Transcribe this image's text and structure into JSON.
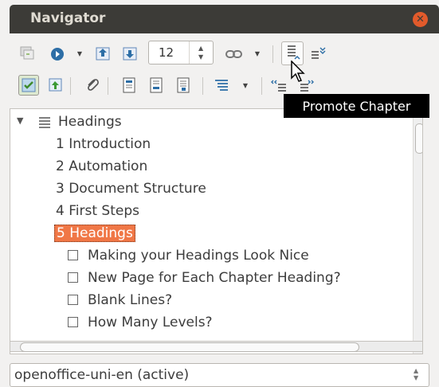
{
  "window": {
    "title": "Navigator"
  },
  "toolbar": {
    "heading_level": "12",
    "tooltip": "Promote Chapter"
  },
  "tree": {
    "root": "Headings",
    "chapters": [
      "1 Introduction",
      "2 Automation",
      "3 Document Structure",
      "4 First Steps"
    ],
    "selected": "5 Headings",
    "subitems": [
      "Making your Headings Look Nice",
      "New Page for Each Chapter Heading?",
      "Blank Lines?",
      "How Many Levels?"
    ]
  },
  "document_select": {
    "value": "openoffice-uni-en (active)"
  },
  "colors": {
    "titlebar": "#3c3b37",
    "close": "#e25a2b",
    "selection": "#f07746",
    "tooltip_bg": "#000000"
  },
  "icons": {
    "toolbar_row1": [
      "toggle-icon",
      "navigation-icon",
      "previous-icon",
      "next-icon",
      "drag-mode-icon",
      "promote-chapter-icon",
      "demote-chapter-icon"
    ],
    "toolbar_row2": [
      "content-view-icon",
      "set-reminder-icon",
      "attachment-icon",
      "header-icon",
      "footer-icon",
      "anchor-icon",
      "heading-levels-icon",
      "promote-level-icon",
      "demote-level-icon"
    ]
  }
}
